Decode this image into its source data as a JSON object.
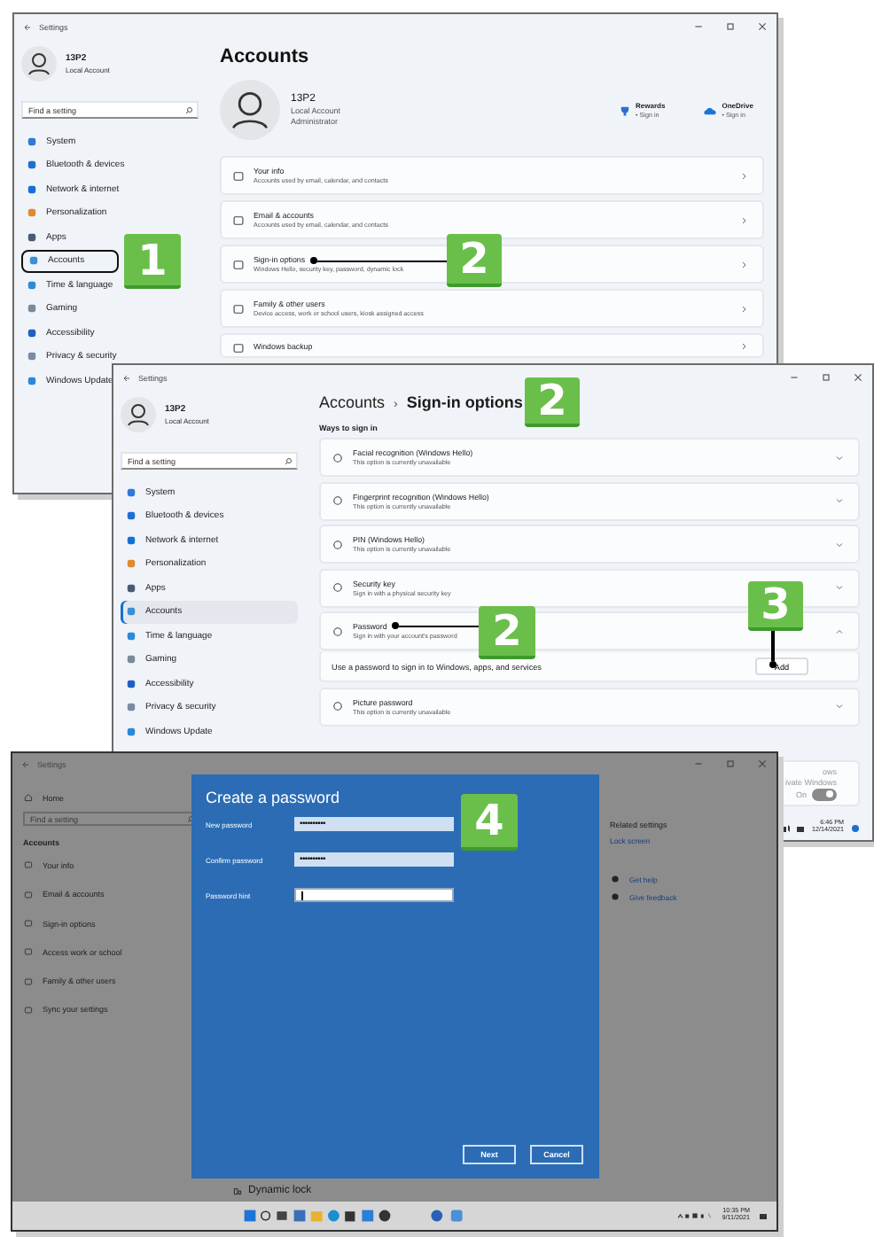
{
  "settings_window": {
    "title": "Settings",
    "profile": {
      "name": "13P2",
      "account": "Local Account"
    },
    "search": {
      "placeholder": "Find a setting"
    },
    "nav": [
      {
        "label": "System",
        "selected": false
      },
      {
        "label": "Bluetooth & devices",
        "selected": false
      },
      {
        "label": "Network & internet",
        "selected": false
      },
      {
        "label": "Personalization",
        "selected": false
      },
      {
        "label": "Apps",
        "selected": false
      },
      {
        "label": "Accounts",
        "selected": true
      },
      {
        "label": "Time & language",
        "selected": false
      },
      {
        "label": "Gaming",
        "selected": false
      },
      {
        "label": "Accessibility",
        "selected": false
      },
      {
        "label": "Privacy & security",
        "selected": false
      },
      {
        "label": "Windows Update",
        "selected": false
      }
    ],
    "heading": "Accounts",
    "account": {
      "name": "13P2",
      "type": "Local Account",
      "role": "Administrator"
    },
    "services": [
      {
        "name": "Rewards",
        "action": "• Sign in"
      },
      {
        "name": "OneDrive",
        "action": "• Sign in"
      }
    ],
    "cards": [
      {
        "title": "Your info",
        "subtitle": "Accounts used by email, calendar, and contacts"
      },
      {
        "title": "Email & accounts",
        "subtitle": "Accounts used by email, calendar, and contacts"
      },
      {
        "title": "Sign-in options",
        "subtitle": "Windows Hello, security key, password, dynamic lock"
      },
      {
        "title": "Family & other users",
        "subtitle": "Device access, work or school users, kiosk assigned access"
      },
      {
        "title": "Windows backup"
      }
    ]
  },
  "sign_in_window": {
    "title": "Settings",
    "profile": {
      "name": "13P2",
      "account": "Local Account"
    },
    "search": {
      "placeholder": "Find a setting"
    },
    "nav": [
      {
        "label": "System",
        "selected": false
      },
      {
        "label": "Bluetooth & devices",
        "selected": false
      },
      {
        "label": "Network & internet",
        "selected": false
      },
      {
        "label": "Personalization",
        "selected": false
      },
      {
        "label": "Apps",
        "selected": false
      },
      {
        "label": "Accounts",
        "selected": true
      },
      {
        "label": "Time & language",
        "selected": false
      },
      {
        "label": "Gaming",
        "selected": false
      },
      {
        "label": "Accessibility",
        "selected": false
      },
      {
        "label": "Privacy & security",
        "selected": false
      },
      {
        "label": "Windows Update",
        "selected": false
      }
    ],
    "breadcrumb": {
      "parent": "Accounts",
      "separator": "›",
      "current": "Sign-in options"
    },
    "section": "Ways to sign in",
    "options": [
      {
        "title": "Facial recognition (Windows Hello)",
        "subtitle": "This option is currently unavailable",
        "expanded": false
      },
      {
        "title": "Fingerprint recognition (Windows Hello)",
        "subtitle": "This option is currently unavailable",
        "expanded": false
      },
      {
        "title": "PIN (Windows Hello)",
        "subtitle": "This option is currently unavailable",
        "expanded": false
      },
      {
        "title": "Security key",
        "subtitle": "Sign in with a physical security key",
        "expanded": false
      },
      {
        "title": "Password",
        "subtitle": "Sign in with your account's password",
        "expanded": true,
        "detail": "Use a password to sign in to Windows, apps, and services",
        "button": "Add"
      },
      {
        "title": "Picture password",
        "subtitle": "This option is currently unavailable",
        "expanded": false
      }
    ],
    "partial_card": {
      "lines": [
        "ows",
        "ivate Windows"
      ],
      "toggle": {
        "label": "On",
        "on": true
      }
    },
    "clock": {
      "time": "6:46 PM",
      "date": "12/14/2021"
    }
  },
  "password_window": {
    "title": "Settings",
    "home": "Home",
    "search": {
      "placeholder": "Find a setting"
    },
    "section": "Accounts",
    "nav": [
      "Your info",
      "Email & accounts",
      "Sign-in options",
      "Access work or school",
      "Family & other users",
      "Sync your settings"
    ],
    "related": {
      "heading": "Related settings",
      "link": "Lock screen"
    },
    "help": [
      "Get help",
      "Give feedback"
    ],
    "behind": "Dynamic lock",
    "dialog": {
      "title": "Create a password",
      "fields": [
        {
          "label": "New password",
          "value": "••••••••••"
        },
        {
          "label": "Confirm password",
          "value": "••••••••••"
        },
        {
          "label": "Password hint"
        }
      ],
      "buttons": [
        "Next",
        "Cancel"
      ]
    },
    "clock": {
      "time": "10:35 PM",
      "date": "9/11/2021"
    }
  },
  "callouts": [
    "1",
    "2",
    "2",
    "2",
    "3",
    "4"
  ]
}
